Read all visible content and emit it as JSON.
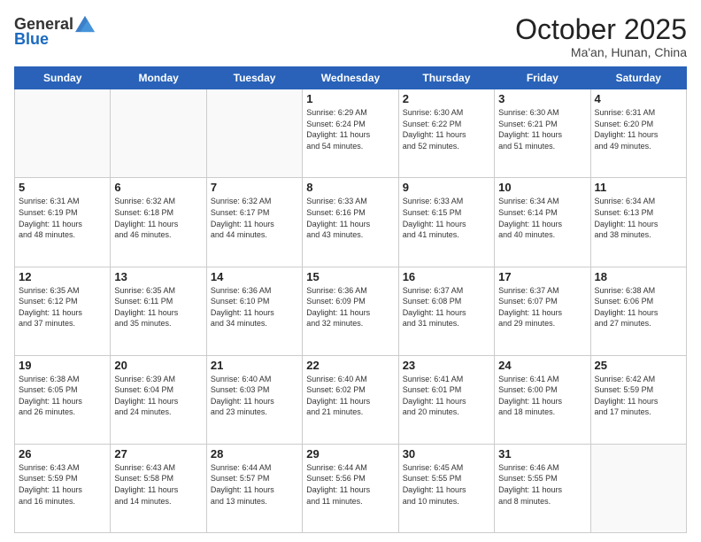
{
  "header": {
    "logo_general": "General",
    "logo_blue": "Blue",
    "month_title": "October 2025",
    "location": "Ma'an, Hunan, China"
  },
  "weekdays": [
    "Sunday",
    "Monday",
    "Tuesday",
    "Wednesday",
    "Thursday",
    "Friday",
    "Saturday"
  ],
  "weeks": [
    [
      {
        "day": "",
        "info": ""
      },
      {
        "day": "",
        "info": ""
      },
      {
        "day": "",
        "info": ""
      },
      {
        "day": "1",
        "info": "Sunrise: 6:29 AM\nSunset: 6:24 PM\nDaylight: 11 hours\nand 54 minutes."
      },
      {
        "day": "2",
        "info": "Sunrise: 6:30 AM\nSunset: 6:22 PM\nDaylight: 11 hours\nand 52 minutes."
      },
      {
        "day": "3",
        "info": "Sunrise: 6:30 AM\nSunset: 6:21 PM\nDaylight: 11 hours\nand 51 minutes."
      },
      {
        "day": "4",
        "info": "Sunrise: 6:31 AM\nSunset: 6:20 PM\nDaylight: 11 hours\nand 49 minutes."
      }
    ],
    [
      {
        "day": "5",
        "info": "Sunrise: 6:31 AM\nSunset: 6:19 PM\nDaylight: 11 hours\nand 48 minutes."
      },
      {
        "day": "6",
        "info": "Sunrise: 6:32 AM\nSunset: 6:18 PM\nDaylight: 11 hours\nand 46 minutes."
      },
      {
        "day": "7",
        "info": "Sunrise: 6:32 AM\nSunset: 6:17 PM\nDaylight: 11 hours\nand 44 minutes."
      },
      {
        "day": "8",
        "info": "Sunrise: 6:33 AM\nSunset: 6:16 PM\nDaylight: 11 hours\nand 43 minutes."
      },
      {
        "day": "9",
        "info": "Sunrise: 6:33 AM\nSunset: 6:15 PM\nDaylight: 11 hours\nand 41 minutes."
      },
      {
        "day": "10",
        "info": "Sunrise: 6:34 AM\nSunset: 6:14 PM\nDaylight: 11 hours\nand 40 minutes."
      },
      {
        "day": "11",
        "info": "Sunrise: 6:34 AM\nSunset: 6:13 PM\nDaylight: 11 hours\nand 38 minutes."
      }
    ],
    [
      {
        "day": "12",
        "info": "Sunrise: 6:35 AM\nSunset: 6:12 PM\nDaylight: 11 hours\nand 37 minutes."
      },
      {
        "day": "13",
        "info": "Sunrise: 6:35 AM\nSunset: 6:11 PM\nDaylight: 11 hours\nand 35 minutes."
      },
      {
        "day": "14",
        "info": "Sunrise: 6:36 AM\nSunset: 6:10 PM\nDaylight: 11 hours\nand 34 minutes."
      },
      {
        "day": "15",
        "info": "Sunrise: 6:36 AM\nSunset: 6:09 PM\nDaylight: 11 hours\nand 32 minutes."
      },
      {
        "day": "16",
        "info": "Sunrise: 6:37 AM\nSunset: 6:08 PM\nDaylight: 11 hours\nand 31 minutes."
      },
      {
        "day": "17",
        "info": "Sunrise: 6:37 AM\nSunset: 6:07 PM\nDaylight: 11 hours\nand 29 minutes."
      },
      {
        "day": "18",
        "info": "Sunrise: 6:38 AM\nSunset: 6:06 PM\nDaylight: 11 hours\nand 27 minutes."
      }
    ],
    [
      {
        "day": "19",
        "info": "Sunrise: 6:38 AM\nSunset: 6:05 PM\nDaylight: 11 hours\nand 26 minutes."
      },
      {
        "day": "20",
        "info": "Sunrise: 6:39 AM\nSunset: 6:04 PM\nDaylight: 11 hours\nand 24 minutes."
      },
      {
        "day": "21",
        "info": "Sunrise: 6:40 AM\nSunset: 6:03 PM\nDaylight: 11 hours\nand 23 minutes."
      },
      {
        "day": "22",
        "info": "Sunrise: 6:40 AM\nSunset: 6:02 PM\nDaylight: 11 hours\nand 21 minutes."
      },
      {
        "day": "23",
        "info": "Sunrise: 6:41 AM\nSunset: 6:01 PM\nDaylight: 11 hours\nand 20 minutes."
      },
      {
        "day": "24",
        "info": "Sunrise: 6:41 AM\nSunset: 6:00 PM\nDaylight: 11 hours\nand 18 minutes."
      },
      {
        "day": "25",
        "info": "Sunrise: 6:42 AM\nSunset: 5:59 PM\nDaylight: 11 hours\nand 17 minutes."
      }
    ],
    [
      {
        "day": "26",
        "info": "Sunrise: 6:43 AM\nSunset: 5:59 PM\nDaylight: 11 hours\nand 16 minutes."
      },
      {
        "day": "27",
        "info": "Sunrise: 6:43 AM\nSunset: 5:58 PM\nDaylight: 11 hours\nand 14 minutes."
      },
      {
        "day": "28",
        "info": "Sunrise: 6:44 AM\nSunset: 5:57 PM\nDaylight: 11 hours\nand 13 minutes."
      },
      {
        "day": "29",
        "info": "Sunrise: 6:44 AM\nSunset: 5:56 PM\nDaylight: 11 hours\nand 11 minutes."
      },
      {
        "day": "30",
        "info": "Sunrise: 6:45 AM\nSunset: 5:55 PM\nDaylight: 11 hours\nand 10 minutes."
      },
      {
        "day": "31",
        "info": "Sunrise: 6:46 AM\nSunset: 5:55 PM\nDaylight: 11 hours\nand 8 minutes."
      },
      {
        "day": "",
        "info": ""
      }
    ]
  ]
}
